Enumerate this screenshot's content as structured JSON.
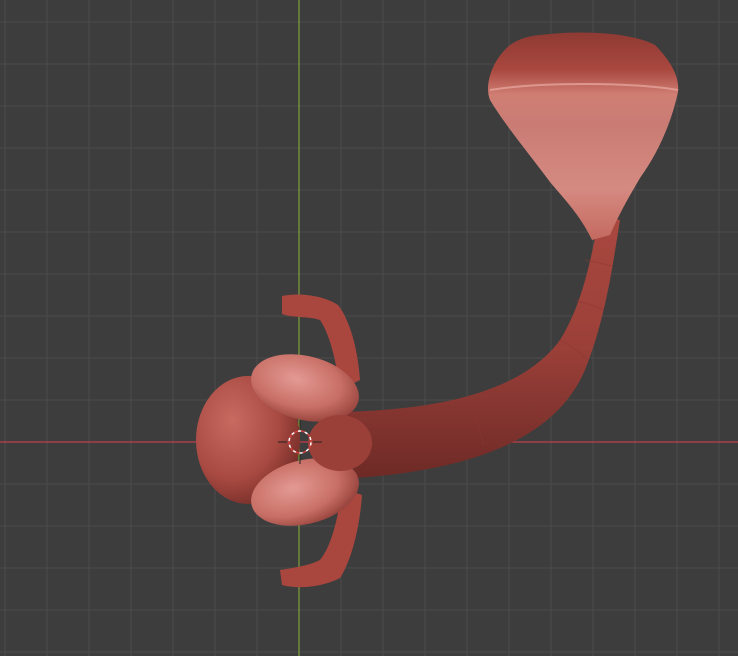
{
  "viewport": {
    "mode": "sculpt-3d-viewport",
    "background_color": "#3d3d3d",
    "grid_color": "#4a4a4a",
    "x_axis_color": "#c0404a",
    "y_axis_color": "#7ea03c",
    "mesh_base_color": "#b5524a",
    "mesh_highlight_color": "#e39a93",
    "mesh_shadow_color": "#6e2a26"
  },
  "scene": {
    "object": "sculpted-creature-mesh",
    "cursor": "3d-cursor-icon"
  }
}
